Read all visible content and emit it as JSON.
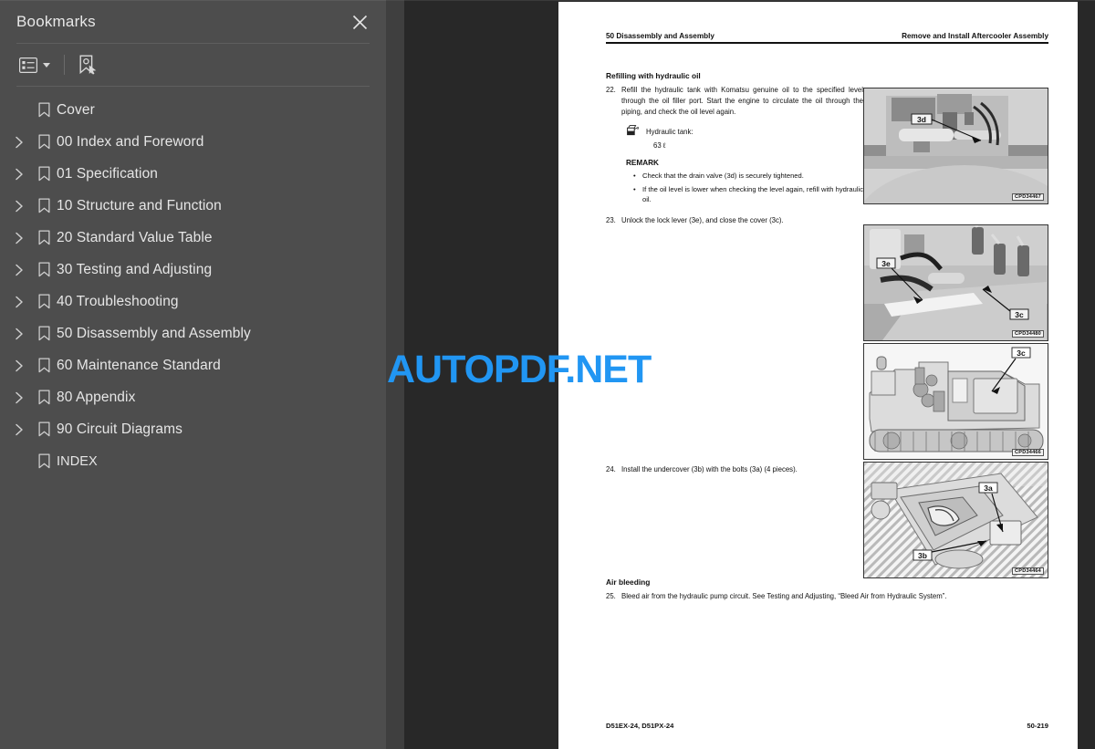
{
  "sidebar": {
    "title": "Bookmarks",
    "close_icon": "close-icon",
    "toolbar": {
      "options_label": "Bookmark options",
      "options_icon": "list-options-icon",
      "find_label": "Expand current bookmark",
      "find_icon": "bookmark-pointer-icon"
    },
    "items": [
      {
        "label": "Cover",
        "expandable": false
      },
      {
        "label": "00 Index and Foreword",
        "expandable": true
      },
      {
        "label": "01 Specification",
        "expandable": true
      },
      {
        "label": "10 Structure and Function",
        "expandable": true
      },
      {
        "label": "20 Standard Value Table",
        "expandable": true
      },
      {
        "label": "30 Testing and Adjusting",
        "expandable": true
      },
      {
        "label": "40 Troubleshooting",
        "expandable": true
      },
      {
        "label": "50 Disassembly and Assembly",
        "expandable": true
      },
      {
        "label": "60 Maintenance Standard",
        "expandable": true
      },
      {
        "label": "80 Appendix",
        "expandable": true
      },
      {
        "label": "90 Circuit Diagrams",
        "expandable": true
      },
      {
        "label": "INDEX",
        "expandable": false
      }
    ]
  },
  "watermark": {
    "text": "AUTOPDF.NET",
    "color": "#2196f3"
  },
  "document": {
    "header": {
      "left": "50 Disassembly and Assembly",
      "right": "Remove and Install Aftercooler Assembly"
    },
    "section1_title": "Refilling with hydraulic oil",
    "step22": {
      "num": "22.",
      "text": "Refill the hydraulic tank with Komatsu genuine oil to the specified level through the oil filler port. Start the engine to circulate the oil through the piping, and check the oil level again."
    },
    "spec": {
      "icon": "oil-fill-icon",
      "label": "Hydraulic tank:",
      "value": "63 ℓ"
    },
    "remark": {
      "title": "REMARK",
      "bullets": [
        "Check that the drain valve (3d) is securely tightened.",
        "If the oil level is lower when checking the level again, refill with hydraulic oil."
      ]
    },
    "step23": {
      "num": "23.",
      "text": "Unlock the lock lever (3e), and close the cover (3c)."
    },
    "step24": {
      "num": "24.",
      "text": "Install the undercover (3b) with the bolts (3a) (4 pieces)."
    },
    "section2_title": "Air bleeding",
    "step25": {
      "num": "25.",
      "text": "Bleed air from the hydraulic pump circuit. See Testing and Adjusting, “Bleed Air from Hydraulic System”."
    },
    "figures": [
      {
        "caption": "CPD34467",
        "callouts": [
          "3d"
        ]
      },
      {
        "caption": "CPD34480",
        "callouts": [
          "3e",
          "3c"
        ]
      },
      {
        "caption": "CPD34466",
        "callouts": [
          "3c"
        ]
      },
      {
        "caption": "CPD34464",
        "callouts": [
          "3a",
          "3b"
        ]
      }
    ],
    "footer": {
      "left": "D51EX-24, D51PX-24",
      "right": "50-219"
    }
  }
}
